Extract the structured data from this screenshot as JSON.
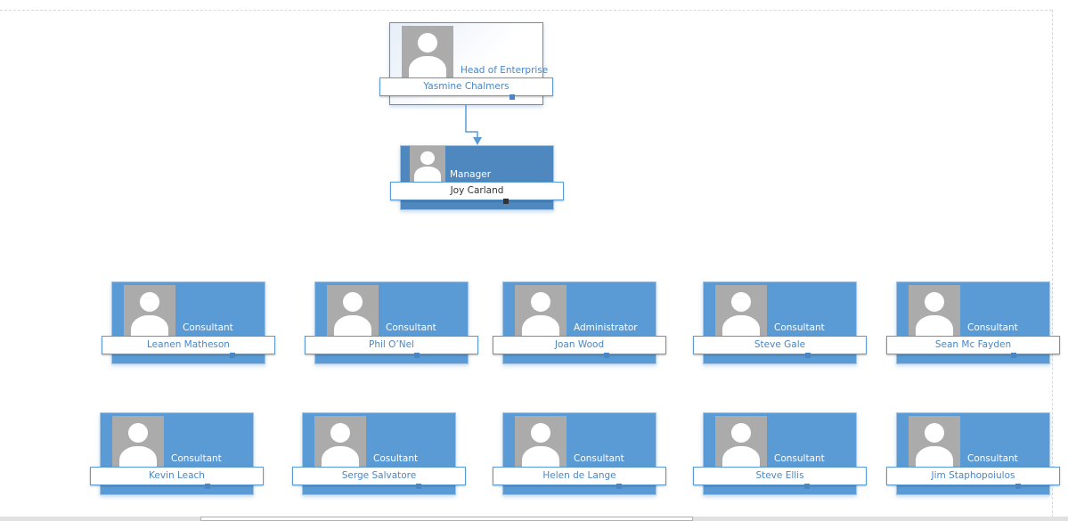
{
  "colors": {
    "card": "#5b9bd5",
    "manager_card": "#4e88bf",
    "name_text": "#4a86c5"
  },
  "head": {
    "title": "Head of Enterprise",
    "name": "Yasmine Chalmers",
    "icon": "person-placeholder-icon"
  },
  "manager": {
    "title": "Manager",
    "name": "Joy Carland",
    "icon": "person-placeholder-icon"
  },
  "staff_rows": [
    [
      {
        "title": "Consultant",
        "name": "Leanen Matheson"
      },
      {
        "title": "Consultant",
        "name": "Phil O’Nel"
      },
      {
        "title": "Administrator",
        "name": "Joan Wood"
      },
      {
        "title": "Consultant",
        "name": "Steve Gale"
      },
      {
        "title": "Consultant",
        "name": "Sean Mc Fayden"
      }
    ],
    [
      {
        "title": "Consultant",
        "name": "Kevin Leach"
      },
      {
        "title": "Cosultant",
        "name": "Serge Salvatore"
      },
      {
        "title": "Consultant",
        "name": "Helen de Lange"
      },
      {
        "title": "Consultant",
        "name": "Steve Ellis"
      },
      {
        "title": "Consultant",
        "name": "Jim Staphopoiulos"
      }
    ]
  ]
}
